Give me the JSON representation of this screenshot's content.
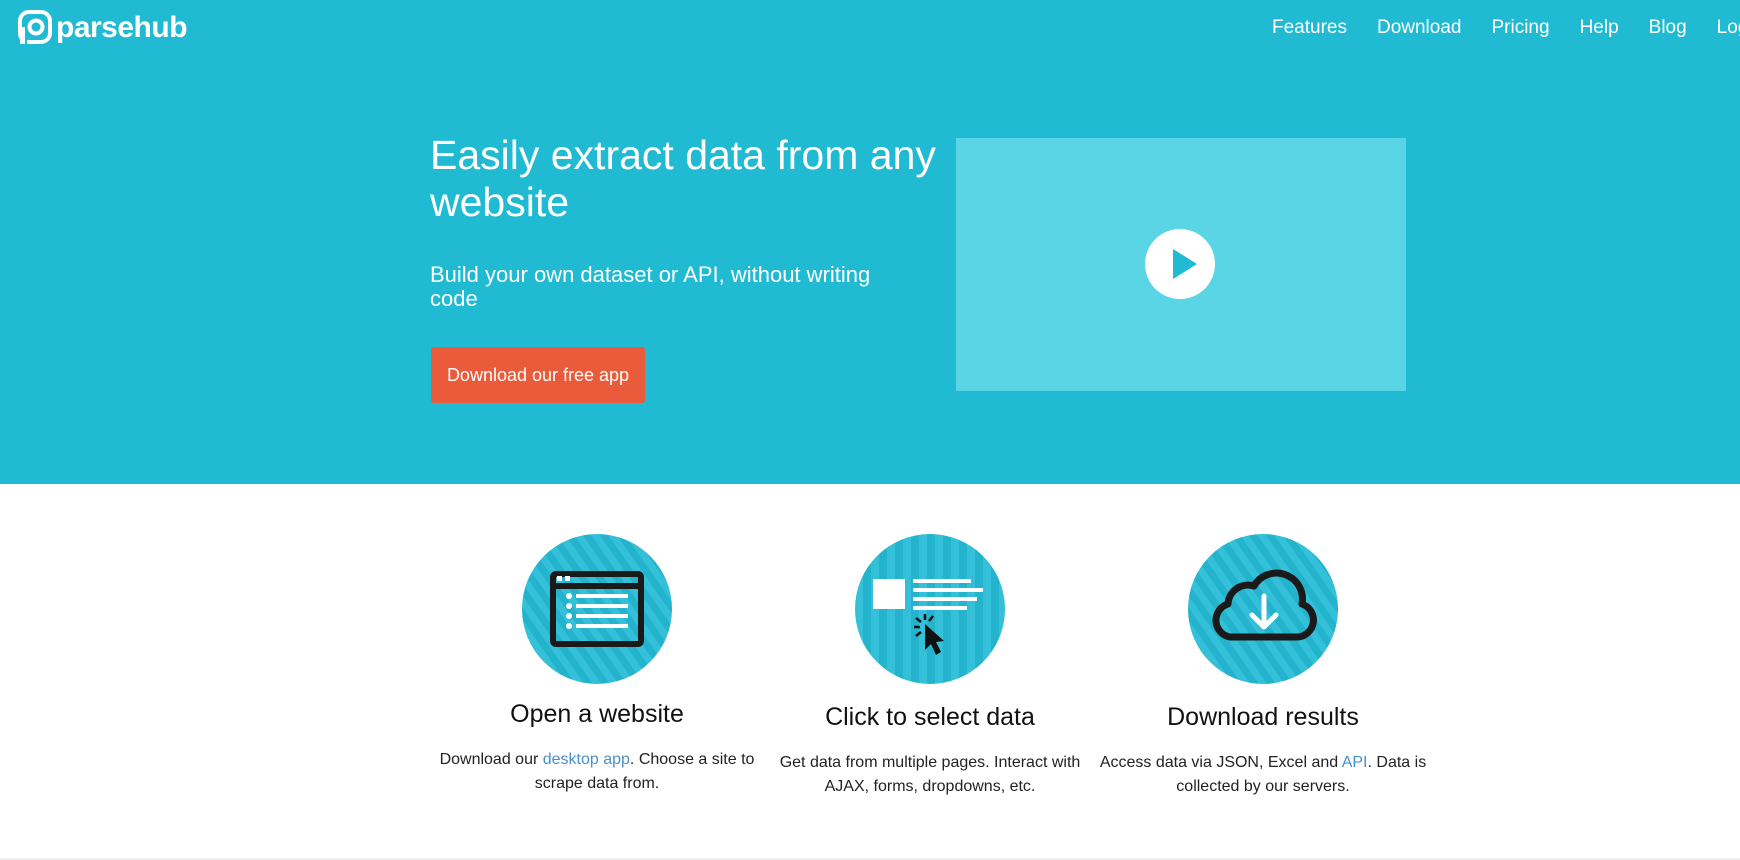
{
  "header": {
    "logo_text": "parsehub",
    "nav": [
      {
        "label": "Features"
      },
      {
        "label": "Download"
      },
      {
        "label": "Pricing"
      },
      {
        "label": "Help"
      },
      {
        "label": "Blog"
      },
      {
        "label": "Log i"
      }
    ]
  },
  "hero": {
    "headline": "Easily extract data from any website",
    "subheadline": "Build your own dataset or API, without writing code",
    "cta_label": "Download our free app",
    "video_icon": "play-icon"
  },
  "features": [
    {
      "icon": "browser-window-icon",
      "title": "Open a website",
      "desc_before": "Download our ",
      "desc_link": "desktop app",
      "desc_after": ". Choose a site to scrape data from."
    },
    {
      "icon": "click-select-icon",
      "title": "Click to select data",
      "desc_before": "Get data from multiple pages. Interact with AJAX, forms, dropdowns, etc.",
      "desc_link": "",
      "desc_after": ""
    },
    {
      "icon": "cloud-download-icon",
      "title": "Download results",
      "desc_before": "Access data via JSON, Excel and ",
      "desc_link": "API",
      "desc_after": ". Data is collected by our servers."
    }
  ],
  "colors": {
    "hero_bg": "#21BAD3",
    "video_bg": "#5AD5E6",
    "cta_bg": "#E95B3A",
    "link": "#4A90C8"
  }
}
